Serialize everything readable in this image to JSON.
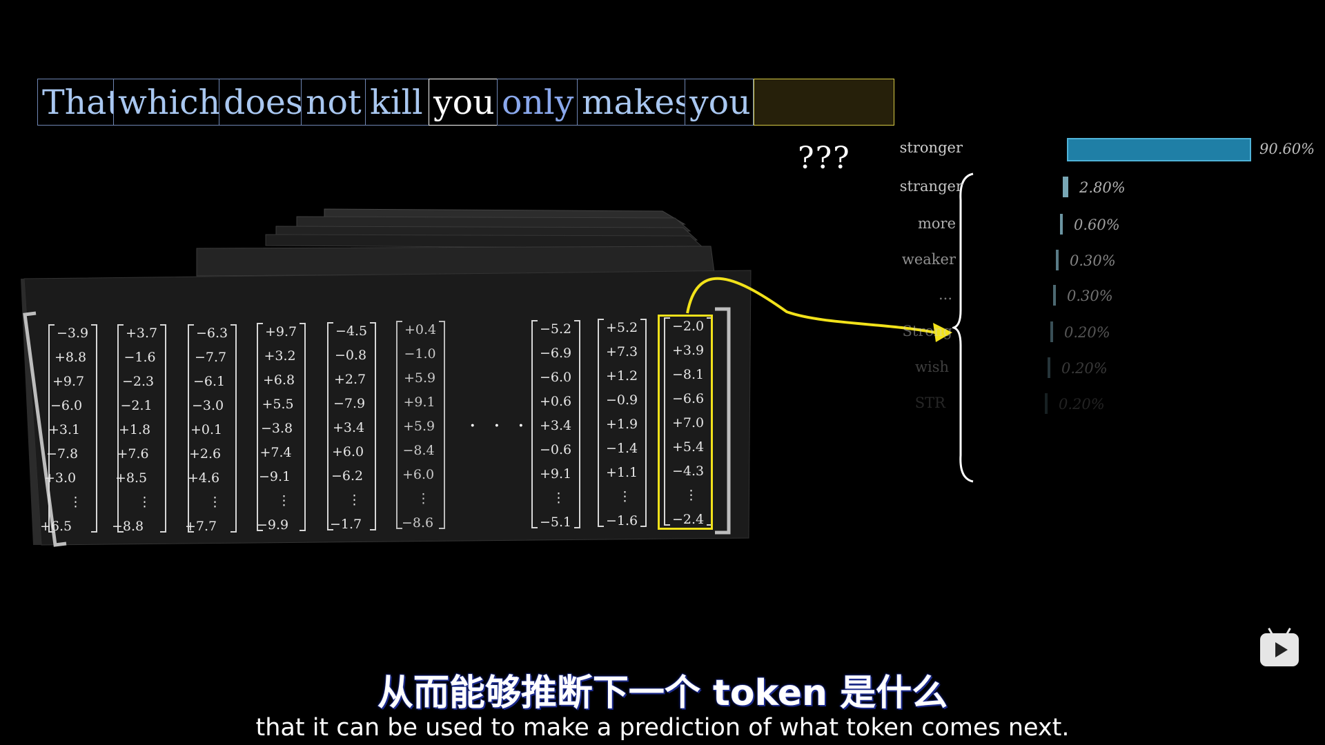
{
  "tokens": [
    {
      "text": "That",
      "style": "lightblue"
    },
    {
      "text": "which",
      "style": "lightblue"
    },
    {
      "text": "does",
      "style": "lightblue"
    },
    {
      "text": "not",
      "style": "lightblue"
    },
    {
      "text": "kill",
      "style": "lightblue"
    },
    {
      "text": "you",
      "style": "white"
    },
    {
      "text": "only",
      "style": "blue"
    },
    {
      "text": "makes",
      "style": "lightblue"
    },
    {
      "text": "you",
      "style": "lightblue"
    }
  ],
  "unknown_marker": "???",
  "columns": [
    [
      "−3.9",
      "+8.8",
      "+9.7",
      "−6.0",
      "+3.1",
      "−7.8",
      "+3.0",
      "⋮",
      "+6.5"
    ],
    [
      "+3.7",
      "−1.6",
      "−2.3",
      "−2.1",
      "+1.8",
      "+7.6",
      "+8.5",
      "⋮",
      "−8.8"
    ],
    [
      "−6.3",
      "−7.7",
      "−6.1",
      "−3.0",
      "+0.1",
      "+2.6",
      "+4.6",
      "⋮",
      "+7.7"
    ],
    [
      "+9.7",
      "+3.2",
      "+6.8",
      "+5.5",
      "−3.8",
      "+7.4",
      "−9.1",
      "⋮",
      "−9.9"
    ],
    [
      "−4.5",
      "−0.8",
      "+2.7",
      "−7.9",
      "+3.4",
      "+6.0",
      "−6.2",
      "⋮",
      "−1.7"
    ],
    [
      "+0.4",
      "−1.0",
      "+5.9",
      "+9.1",
      "+5.9",
      "−8.4",
      "+6.0",
      "⋮",
      "−8.6"
    ],
    [
      "−5.2",
      "−6.9",
      "−6.0",
      "+0.6",
      "+3.4",
      "−0.6",
      "+9.1",
      "⋮",
      "−5.1"
    ],
    [
      "+5.2",
      "+7.3",
      "+1.2",
      "−0.9",
      "+1.9",
      "−1.4",
      "+1.1",
      "⋮",
      "−1.6"
    ],
    [
      "−2.0",
      "+3.9",
      "−8.1",
      "−6.6",
      "+7.0",
      "+5.4",
      "−4.3",
      "⋮",
      "−2.4"
    ]
  ],
  "ellipsis": "· · ·",
  "predictions": [
    {
      "word": "stronger",
      "pct": "90.60%",
      "value": 90.6,
      "opacity": 1.0
    },
    {
      "word": "stranger",
      "pct": "2.80%",
      "value": 2.8,
      "opacity": 0.95
    },
    {
      "word": "more",
      "pct": "0.60%",
      "value": 0.6,
      "opacity": 0.85
    },
    {
      "word": "weaker",
      "pct": "0.30%",
      "value": 0.3,
      "opacity": 0.7
    },
    {
      "word": "...",
      "pct": "0.30%",
      "value": 0.3,
      "opacity": 0.6
    },
    {
      "word": "Strong",
      "pct": "0.20%",
      "value": 0.2,
      "opacity": 0.45
    },
    {
      "word": "wish",
      "pct": "0.20%",
      "value": 0.2,
      "opacity": 0.3
    },
    {
      "word": "STR",
      "pct": "0.20%",
      "value": 0.2,
      "opacity": 0.18
    }
  ],
  "colors": {
    "accent_bar": "#1f7fa6",
    "highlight": "#f2e21a",
    "token_blue": "#8aa8ec",
    "token_light": "#a9c7f0"
  },
  "subtitle_cn": "从而能够推断下一个 token 是什么",
  "subtitle_en": "that it can be used to make a prediction of what token comes next.",
  "icons": {
    "player": "bilibili-play-icon"
  }
}
